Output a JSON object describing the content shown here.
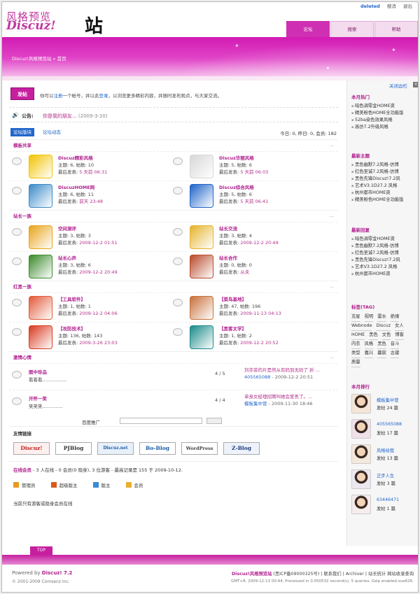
{
  "header": {
    "logo_cn": "风格预览",
    "logo_en": "Discuz!",
    "logo_big": "站",
    "top_links": [
      "deleted",
      "搜消",
      "退出"
    ],
    "nav": [
      "论坛",
      "搜索",
      "帮助"
    ]
  },
  "breadcrumb": {
    "site": "Discuz!风格预览站",
    "sep": "»",
    "page": "首页"
  },
  "post": {
    "button": "发帖",
    "w1": "你可以",
    "register": "注册",
    "w2": "一个帐号，并以此",
    "login": "登录",
    "w3": "，以浏览更多精彩内容，并随时发布观点，与大家交流。"
  },
  "notice": {
    "label": "公告:",
    "text": "你是我的朋友...",
    "date": "(2009-3-20)"
  },
  "tabs": {
    "forums": "论坛版块",
    "activity": "论坛动态"
  },
  "stats": "今日: 0, 昨日: 0, 会员: 182",
  "categories": [
    {
      "name": "模板共享",
      "forums": [
        {
          "name": "Discuz精彩风格",
          "topics": "主题: 6, 帖数: 10",
          "last": "最后发表: ",
          "time": "5 天前 06:31",
          "icon": "smiley-icon",
          "color": "#f3c300"
        },
        {
          "name": "Discuz华丽风格",
          "topics": "主题: 5, 帖数: 6",
          "last": "最后发表: ",
          "time": "5 天前 06:03",
          "icon": "newspaper-icon",
          "color": "#d7d7d7"
        },
        {
          "name": "DiscuzHOME网",
          "topics": "主题: 6, 帖数: 11",
          "last": "最后发表: ",
          "time": "前天 23:48",
          "icon": "puzzle-icon",
          "color": "#3a8ac8"
        },
        {
          "name": "Discuz综合风格",
          "topics": "主题: 5, 帖数: 6",
          "last": "最后发表: ",
          "time": "5 天前 06:41",
          "icon": "globe-icon",
          "color": "#1e64c8"
        }
      ]
    },
    {
      "name": "站长一族",
      "forums": [
        {
          "name": "空间测评",
          "topics": "主题: 3, 帖数: 3",
          "last": "最后发表: ",
          "time": "2009-12-2 01:51",
          "icon": "windows-icon",
          "color": "#e8a41a"
        },
        {
          "name": "站长交流",
          "topics": "主题: 3, 帖数: 4",
          "last": "最后发表: ",
          "time": "2009-12-2 20:49",
          "icon": "zend-icon",
          "color": "#e5b42c"
        },
        {
          "name": "站长心声",
          "topics": "主题: 3, 帖数: 6",
          "last": "最后发表: ",
          "time": "2009-12-2 20:49",
          "icon": "check-icon",
          "color": "#3a8a2a"
        },
        {
          "name": "站长合作",
          "topics": "主题: 0, 帖数: 0",
          "last": "最后发表: ",
          "time": "从未",
          "icon": "flash-icon",
          "color": "#b84a2a"
        }
      ]
    },
    {
      "name": "红黑一族",
      "forums": [
        {
          "name": "【工具软件】",
          "topics": "主题: 1, 帖数: 1",
          "last": "最后发表: ",
          "time": "2009-12-2 04:06",
          "icon": "flower-icon",
          "color": "#e25a3a"
        },
        {
          "name": "【菜鸟基地】",
          "topics": "主题: 47, 帖数: 196",
          "last": "最后发表: ",
          "time": "2009-11-13 04:13",
          "icon": "photo-icon",
          "color": "#c8703a"
        },
        {
          "name": "【攻防技术】",
          "topics": "主题: 136, 帖数: 143",
          "last": "最后发表: ",
          "time": "2009-3-26 23:03",
          "icon": "bloom-icon",
          "color": "#d83a20"
        },
        {
          "name": "【黑客文学】",
          "topics": "主题: 1, 帖数: 2",
          "last": "最后发表: ",
          "time": "2009-12-2 20:52",
          "icon": "cursor-icon",
          "color": "#1a8a8a"
        }
      ]
    }
  ],
  "emotion": {
    "name": "激情心情",
    "forums": [
      {
        "name": "图中珍品",
        "desc": "看看看.................",
        "count": "4 / 5",
        "last_title": "刘亦菲的片是然从有码到无码了 折 ...",
        "last_user": "405565088",
        "last_date": "- 2009-12-2 20:51"
      },
      {
        "name": "开怀一笑",
        "desc": "笑笑笑..............",
        "count": "4 / 4",
        "last_title": "单身女经理招聘叫她会爱丢了。...",
        "last_user": "模板集中营",
        "last_date": "- 2009-11-30 18:46"
      }
    ],
    "ad_label": "百度推广"
  },
  "friends": {
    "title": "友情链接",
    "links": [
      "Discuz!",
      "PJBlog",
      "Discuz.net",
      "Bo-Blog",
      "WordPress",
      "Z-Blog"
    ]
  },
  "online": {
    "title": "在线会员",
    "summary": " - 3 人在线 - 0 会员(0 隐身), 3 位游客 - 最高记录是 155 于 2009-10-12.",
    "legend": [
      "管理员",
      "超级版主",
      "版主",
      "会员"
    ],
    "note": "当前只有游客或隐身会员在线"
  },
  "sidebar": {
    "close": "关闭边栏",
    "hot_title": "本月热门",
    "hot": [
      "暗色调零金HOME资",
      "精美粉色HOME全功能版",
      "52ba染色效果风格",
      "高仿7.2升级风格"
    ],
    "new_title": "最新主题",
    "new": [
      "黑色幽默7.2风格-仿博",
      "红色至诚7.2风格-仿博",
      "黑色先锋Discuz!7.2风",
      "艺术V3.1D27.2 风格",
      "杭州都市HOME资",
      "精美粉色HOME全功能版"
    ],
    "reply_title": "最新回复",
    "reply": [
      "暗色调零金HOME资",
      "黑色幽默7.2风格-仿博",
      "红色至诚7.2风格-仿博",
      "黑色先锋Discuz!7.2风",
      "艺术V3.1D27.2 风格",
      "杭州都市HOME资"
    ],
    "tags_title": "标签(TAG)",
    "tags": [
      "克星",
      "视明",
      "雷水",
      "绝缘",
      "Webnode",
      "Discuz",
      "女人",
      "HOME",
      "黑色",
      "文色",
      "博客",
      "内衣",
      "风格",
      "黑色",
      "音斗",
      "类型",
      "嘉兴",
      "暮宸",
      "古建",
      "质量"
    ],
    "rank_title": "本月排行",
    "rank": [
      {
        "name": "模板集中营",
        "count": "发帖 24 篇"
      },
      {
        "name": "405565088",
        "count": "发帖 17 篇"
      },
      {
        "name": "风格给我",
        "count": "发帖 13 篇"
      },
      {
        "name": "正步人生",
        "count": "发帖 3 篇"
      },
      {
        "name": "63446471",
        "count": "发帖 1 篇"
      }
    ]
  },
  "footer": {
    "top": "TOP",
    "powered": "Powered by ",
    "powered_name": "Discuz! 7.2",
    "copy": "© 2001-2009 Comsenz Inc.",
    "right1_site": "Discuz!风格预览站",
    "right1_rest": " (黑ICP备09000325号) | 联系我们 | Archiver | 站长统计 网站收录查询",
    "right2": "GMT+8, 2009-12-13 00:44, Processed in 0.050532 second(s), 5 queries, Gzip enabled.xue626."
  }
}
